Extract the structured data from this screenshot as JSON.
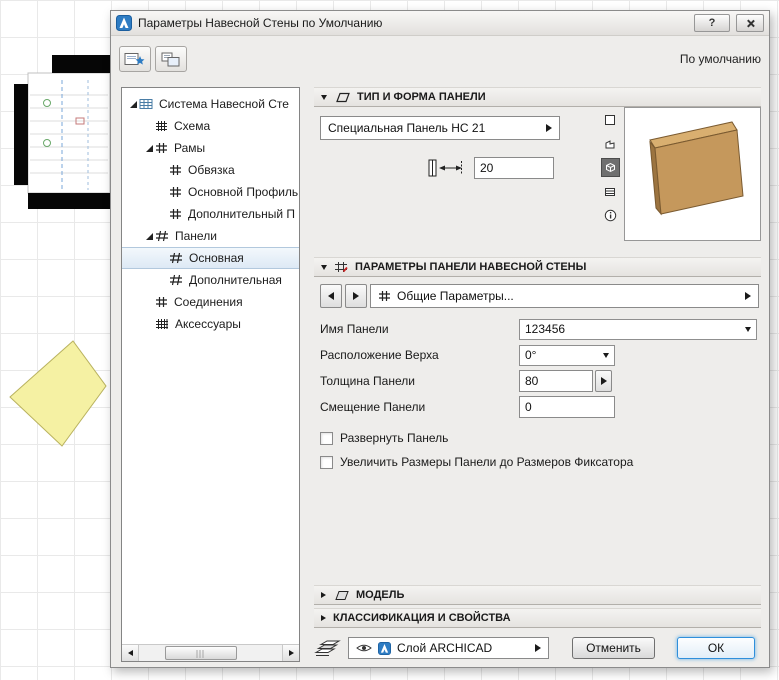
{
  "window": {
    "title": "Параметры Навесной Стены по Умолчанию",
    "help_label": "?",
    "default_label": "По умолчанию"
  },
  "tree": {
    "items": [
      {
        "label": "Система Навесной Сте"
      },
      {
        "label": "Схема"
      },
      {
        "label": "Рамы"
      },
      {
        "label": "Обвязка"
      },
      {
        "label": "Основной Профиль"
      },
      {
        "label": "Дополнительный П"
      },
      {
        "label": "Панели"
      },
      {
        "label": "Основная"
      },
      {
        "label": "Дополнительная"
      },
      {
        "label": "Соединения"
      },
      {
        "label": "Аксессуары"
      }
    ]
  },
  "type_section": {
    "title": "ТИП И ФОРМА ПАНЕЛИ",
    "panel_type": "Специальная Панель НС 21",
    "thickness": "20"
  },
  "params_section": {
    "title": "ПАРАМЕТРЫ ПАНЕЛИ НАВЕСНОЙ СТЕНЫ",
    "page": "Общие Параметры...",
    "fields": [
      {
        "label": "Имя Панели",
        "value": "123456"
      },
      {
        "label": "Расположение Верха",
        "value": "0°"
      },
      {
        "label": "Толщина Панели",
        "value": "80"
      },
      {
        "label": "Смещение Панели",
        "value": "0"
      }
    ],
    "checkboxes": [
      {
        "label": "Развернуть Панель",
        "checked": false
      },
      {
        "label": "Увеличить Размеры Панели до Размеров Фиксатора",
        "checked": false
      }
    ]
  },
  "model_section": {
    "title": "МОДЕЛЬ"
  },
  "classification_section": {
    "title": "КЛАССИФИКАЦИЯ И СВОЙСТВА"
  },
  "footer": {
    "layer": "Слой ARCHICAD",
    "cancel": "Отменить",
    "ok": "ОК"
  },
  "colors": {
    "accent_blue": "#2e7cc3",
    "panel_tan": "#c5985c",
    "selection": "#dde9f5",
    "yellow_shape": "#f5f1a3"
  }
}
